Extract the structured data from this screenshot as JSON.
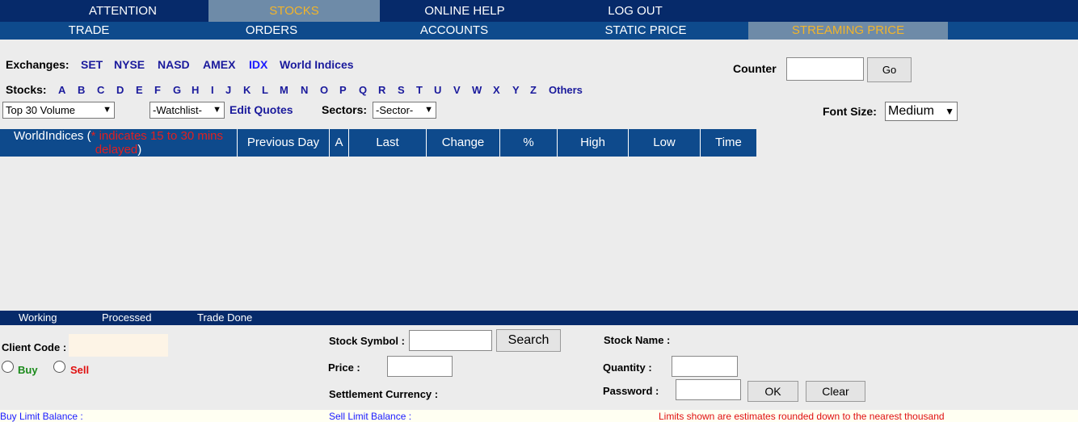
{
  "nav_top": [
    "ATTENTION",
    "STOCKS",
    "ONLINE HELP",
    "LOG OUT"
  ],
  "nav_sub": [
    "TRADE",
    "ORDERS",
    "ACCOUNTS",
    "STATIC PRICE",
    "STREAMING PRICE"
  ],
  "exchanges": {
    "label": "Exchanges:",
    "items": [
      "SET",
      "NYSE",
      "NASD",
      "AMEX",
      "IDX",
      "World Indices"
    ]
  },
  "counter": {
    "label": "Counter",
    "value": "",
    "go": "Go"
  },
  "stocks": {
    "label": "Stocks:",
    "letters": [
      "A",
      "B",
      "C",
      "D",
      "E",
      "F",
      "G",
      "H",
      "I",
      "J",
      "K",
      "L",
      "M",
      "N",
      "O",
      "P",
      "Q",
      "R",
      "S",
      "T",
      "U",
      "V",
      "W",
      "X",
      "Y",
      "Z",
      "Others"
    ]
  },
  "filters": {
    "volume_select": "Top 30 Volume",
    "watchlist_select": "-Watchlist-",
    "edit_quotes": "Edit Quotes",
    "sectors_label": "Sectors:",
    "sector_select": "-Sector-",
    "font_size_label": "Font Size:",
    "font_size_select": "Medium"
  },
  "table": {
    "first_col_name": "WorldIndices (",
    "first_col_note": "* indicates 15 to 30 mins delayed",
    "first_col_close": ")",
    "columns": [
      "Previous Day",
      "A",
      "Last",
      "Change",
      "%",
      "High",
      "Low",
      "Time"
    ]
  },
  "order_tabs": [
    "Working",
    "Processed",
    "Trade Done"
  ],
  "order_form": {
    "client_code_label": "Client Code :",
    "buy_label": "Buy",
    "sell_label": "Sell",
    "stock_symbol_label": "Stock Symbol :",
    "search_button": "Search",
    "price_label": "Price :",
    "settlement_label": "Settlement Currency :",
    "stock_name_label": "Stock Name :",
    "quantity_label": "Quantity :",
    "password_label": "Password :",
    "ok_button": "OK",
    "clear_button": "Clear"
  },
  "footer": {
    "buy_limit": "Buy Limit Balance :",
    "sell_limit": "Sell Limit Balance :",
    "note": "Limits shown are estimates rounded down to the nearest thousand"
  },
  "colors": {
    "nav_dark": "#062a6a",
    "nav_blue": "#0e4a8c",
    "active_tab": "#6e8ba8",
    "active_text": "#f2b42a",
    "link_blue": "#1a1a9c",
    "delay_note": "#e02020",
    "buy": "#1a8a1a",
    "sell": "#e01010"
  }
}
